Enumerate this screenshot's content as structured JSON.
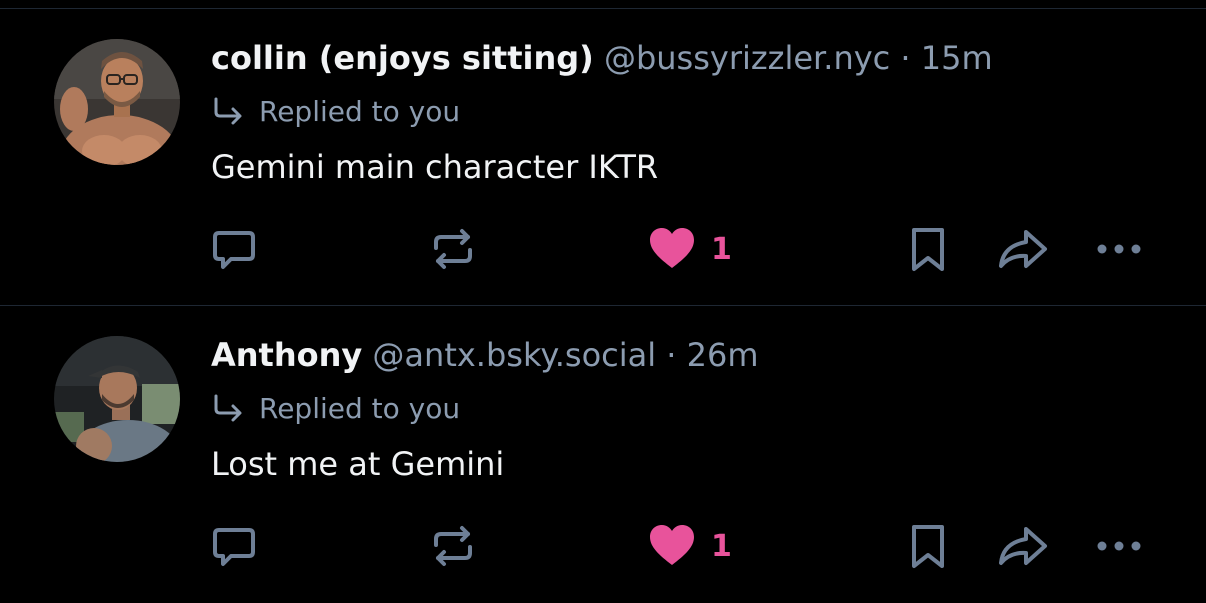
{
  "colors": {
    "background": "#000000",
    "primary_text": "#f1f3f5",
    "secondary_text": "#8c9cb0",
    "icon": "#6e7f96",
    "divider": "#1e2733",
    "like_accent": "#e8539b"
  },
  "posts": [
    {
      "avatar_icon": "avatar-photo",
      "display_name": "collin (enjoys sitting)",
      "handle": "@bussyrizzler.nyc",
      "separator": "·",
      "time": "15m",
      "reply_icon": "reply-arrow-icon",
      "reply_label": "Replied to you",
      "text": "Gemini main character IKTR",
      "actions": {
        "reply_icon": "comment-icon",
        "repost_icon": "repost-icon",
        "like_icon": "heart-icon",
        "like_count": "1",
        "liked": true,
        "bookmark_icon": "bookmark-icon",
        "share_icon": "share-icon",
        "more_icon": "more-icon"
      }
    },
    {
      "avatar_icon": "avatar-photo",
      "display_name": "Anthony",
      "handle": "@antx.bsky.social",
      "separator": "·",
      "time": "26m",
      "reply_icon": "reply-arrow-icon",
      "reply_label": "Replied to you",
      "text": "Lost me at Gemini",
      "actions": {
        "reply_icon": "comment-icon",
        "repost_icon": "repost-icon",
        "like_icon": "heart-icon",
        "like_count": "1",
        "liked": true,
        "bookmark_icon": "bookmark-icon",
        "share_icon": "share-icon",
        "more_icon": "more-icon"
      }
    }
  ]
}
